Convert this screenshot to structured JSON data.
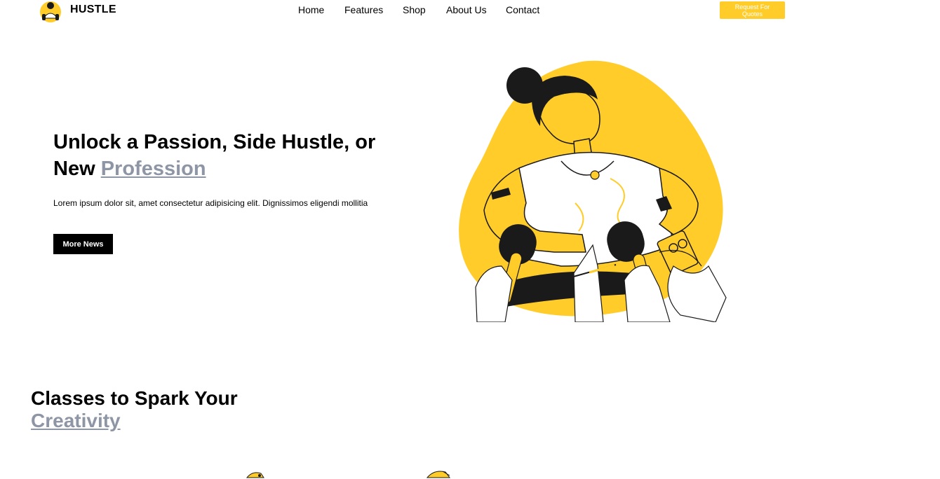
{
  "brand": {
    "name": "HUSTLE",
    "logo_icon": "hustle-logo-icon"
  },
  "nav": {
    "items": [
      {
        "label": "Home"
      },
      {
        "label": "Features"
      },
      {
        "label": "Shop"
      },
      {
        "label": "About Us"
      },
      {
        "label": "Contact"
      }
    ],
    "cta_label": "Request For Quotes"
  },
  "hero": {
    "title_part1": "Unlock a Passion, Side Hustle, or New",
    "title_highlight": "Profession",
    "description": "Lorem ipsum dolor sit, amet consectetur adipisicing elit. Dignissimos eligendi mollitia",
    "button_label": "More News",
    "illustration": "woman-interview-microphones-illustration"
  },
  "classes": {
    "title_part1": "Classes to Spark Your",
    "title_highlight": "Creativity"
  },
  "colors": {
    "accent": "#ffcc29",
    "highlight_text": "#8e96a6",
    "dark": "#000000"
  }
}
